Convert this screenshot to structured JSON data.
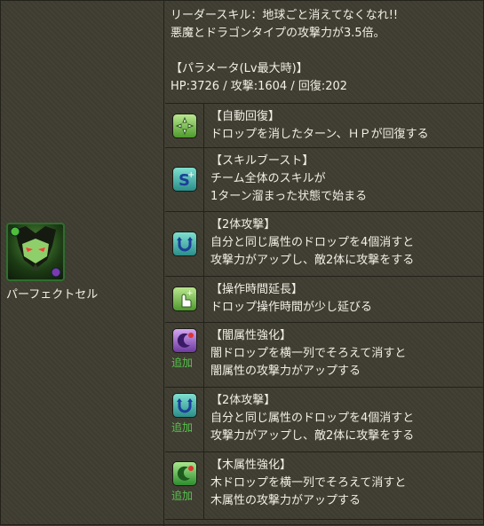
{
  "monster": {
    "name": "パーフェクトセル"
  },
  "header": {
    "leader_skill_line1": "リーダースキル：地球ごと消えてなくなれ!!",
    "leader_skill_line2": "悪魔とドラゴンタイプの攻撃力が3.5倍。",
    "params_heading": "【パラメータ(Lv最大時)】",
    "params_values": "HP:3726 / 攻撃:1604 / 回復:202"
  },
  "awakenings": [
    {
      "icon": "auto-recover-icon",
      "title": "【自動回復】",
      "desc": [
        "ドロップを消したターン、ＨＰが回復する"
      ],
      "tag": ""
    },
    {
      "icon": "skill-boost-icon",
      "title": "【スキルブースト】",
      "desc": [
        "チーム全体のスキルが",
        "1ターン溜まった状態で始まる"
      ],
      "tag": ""
    },
    {
      "icon": "two-pronged-attack-icon",
      "title": "【2体攻撃】",
      "desc": [
        "自分と同じ属性のドロップを4個消すと",
        "攻撃力がアップし、敵2体に攻撃をする"
      ],
      "tag": ""
    },
    {
      "icon": "extend-time-icon",
      "title": "【操作時間延長】",
      "desc": [
        "ドロップ操作時間が少し延びる"
      ],
      "tag": ""
    },
    {
      "icon": "enhanced-dark-orbs-icon",
      "title": "【闇属性強化】",
      "desc": [
        "闇ドロップを横一列でそろえて消すと",
        "闇属性の攻撃力がアップする"
      ],
      "tag": "追加"
    },
    {
      "icon": "two-pronged-attack-icon",
      "title": "【2体攻撃】",
      "desc": [
        "自分と同じ属性のドロップを4個消すと",
        "攻撃力がアップし、敵2体に攻撃をする"
      ],
      "tag": "追加"
    },
    {
      "icon": "enhanced-wood-orbs-icon",
      "title": "【木属性強化】",
      "desc": [
        "木ドロップを横一列でそろえて消すと",
        "木属性の攻撃力がアップする"
      ],
      "tag": "追加"
    }
  ]
}
